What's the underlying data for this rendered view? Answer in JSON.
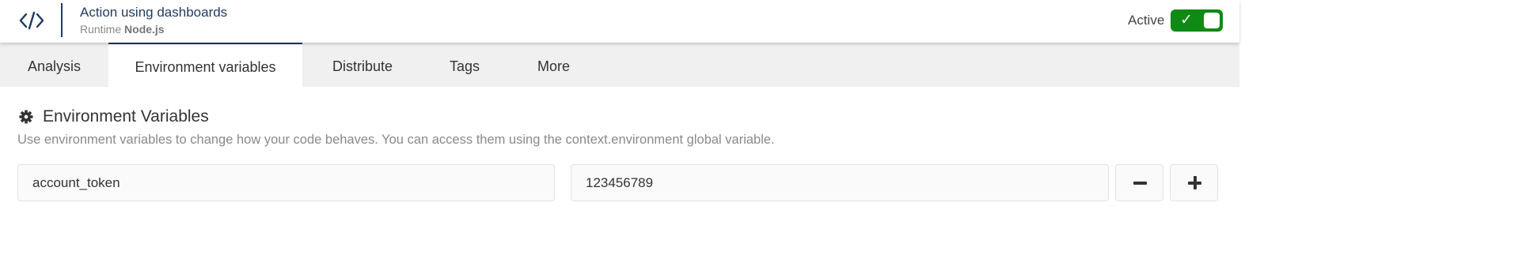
{
  "header": {
    "title": "Action using dashboards",
    "runtime_label": "Runtime",
    "runtime_value": "Node.js",
    "active_label": "Active",
    "active_toggle_state": "on",
    "active_toggle_color": "#0f8a15",
    "icon": "code-icon"
  },
  "tabs": [
    {
      "label": "Analysis",
      "active": false
    },
    {
      "label": "Environment variables",
      "active": true
    },
    {
      "label": "Distribute",
      "active": false
    },
    {
      "label": "Tags",
      "active": false
    },
    {
      "label": "More",
      "active": false
    }
  ],
  "section": {
    "icon": "gear-icon",
    "title": "Environment Variables",
    "description": "Use environment variables to change how your code behaves. You can access them using the context.environment global variable."
  },
  "variables": [
    {
      "key": "account_token",
      "value": "123456789"
    }
  ],
  "buttons": {
    "remove_icon": "minus-icon",
    "add_icon": "plus-icon"
  },
  "colors": {
    "brand": "#1f3a5f",
    "active_green": "#0f8a15",
    "tab_bar_bg": "#f0f0f0"
  }
}
